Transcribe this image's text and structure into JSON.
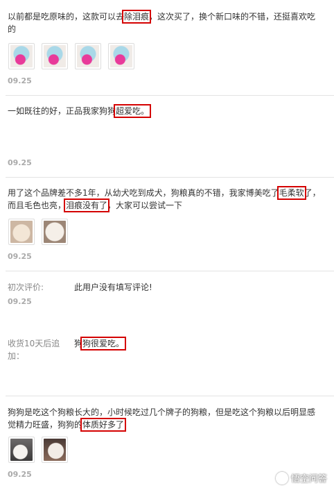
{
  "reviews": [
    {
      "text_before": "以前都是吃原味的，这款可以去",
      "highlight": "除泪痕",
      "text_after": "，这次买了，换个新口味的不错，还挺喜欢吃的",
      "date": "09.25"
    },
    {
      "text_before": "一如既往的好，正品我家狗狗",
      "highlight": "超爱吃。",
      "text_after": "",
      "date": "09.25"
    },
    {
      "text_before": "用了这个品牌差不多1年，从幼犬吃到成犬，狗粮真的不错，我家博美吃了",
      "highlight": "毛柔软",
      "text_mid": "了，而且毛色也亮，",
      "highlight2": "泪痕没有了",
      "text_after": "，大家可以尝试一下",
      "date": "09.25"
    },
    {
      "initial_label": "初次评价:",
      "initial_text": "此用户没有填写评论!",
      "date": "09.25",
      "followup_label": "收货10天后追加：",
      "followup_before": "狗",
      "followup_highlight": "狗很爱吃。"
    },
    {
      "text_before": "狗狗是吃这个狗粮长大的，小时候吃过几个牌子的狗粮，但是吃这个狗粮以后明显感觉精力旺盛，狗狗的",
      "highlight": "体质好多了",
      "text_after": "",
      "date": "09.25"
    }
  ],
  "watermark": "悟空问答"
}
